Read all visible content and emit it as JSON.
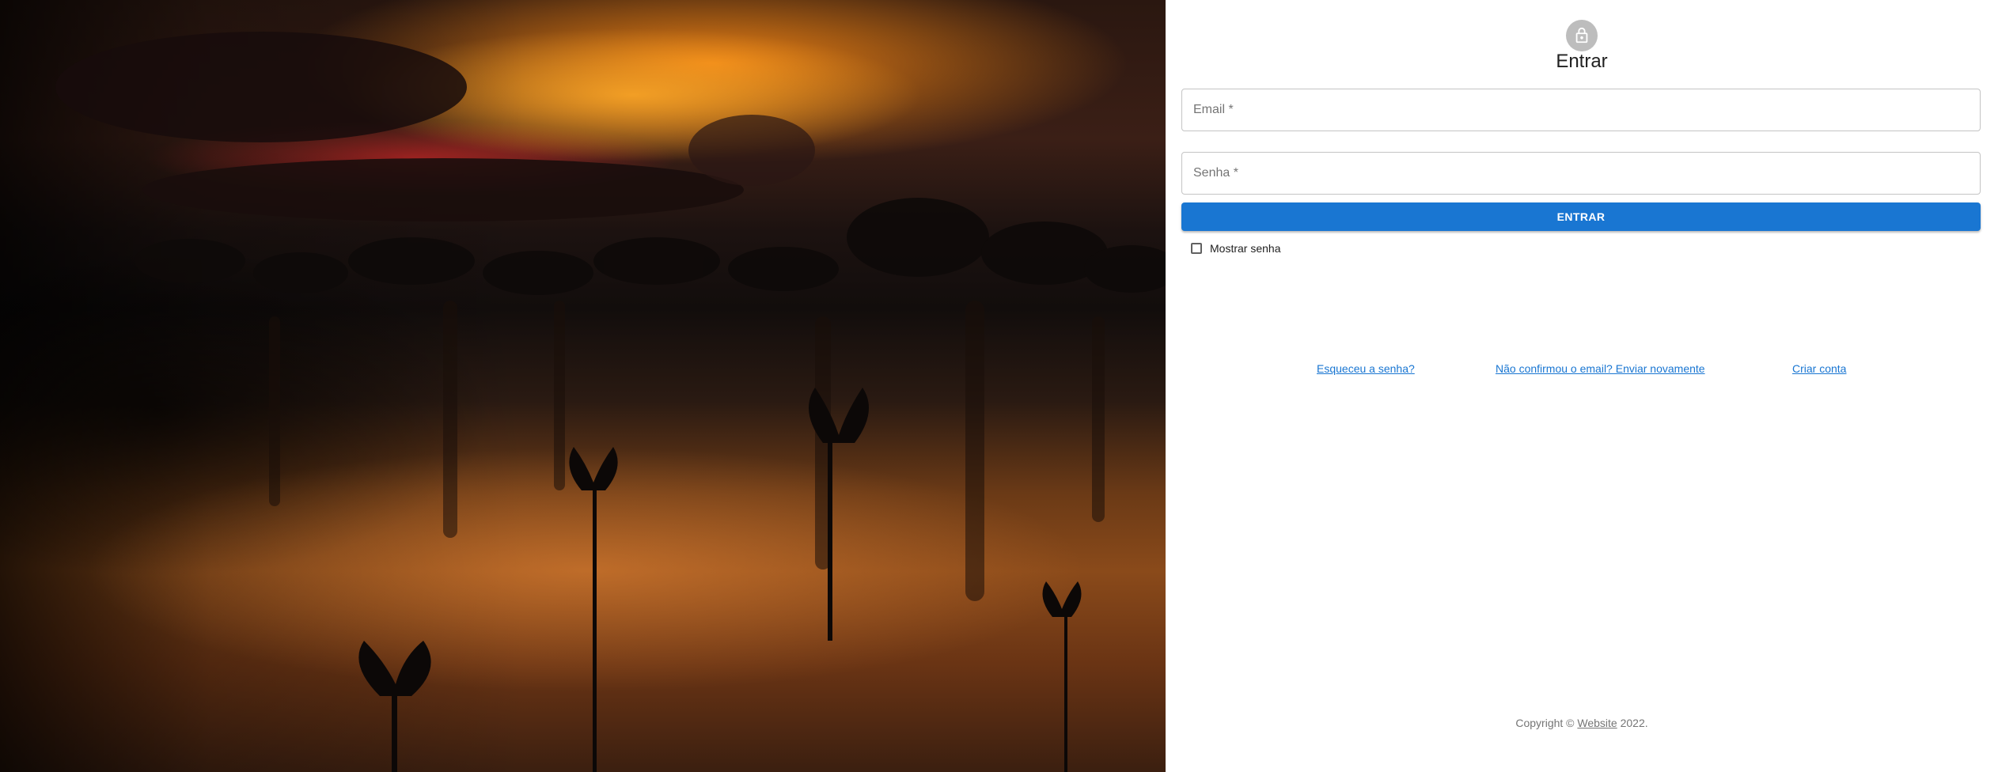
{
  "login": {
    "title": "Entrar",
    "email_placeholder": "Email *",
    "password_placeholder": "Senha *",
    "submit_label": "ENTRAR",
    "show_password_label": "Mostrar senha"
  },
  "links": {
    "forgot_password": "Esqueceu a senha?",
    "resend_confirmation": "Não confirmou o email? Enviar novamente",
    "create_account": "Criar conta"
  },
  "footer": {
    "prefix": "Copyright ©",
    "site_link": "Website",
    "year": "2022."
  },
  "icons": {
    "lock": "lock-icon"
  },
  "colors": {
    "primary": "#1976d2",
    "avatar_bg": "#bdbdbd"
  }
}
